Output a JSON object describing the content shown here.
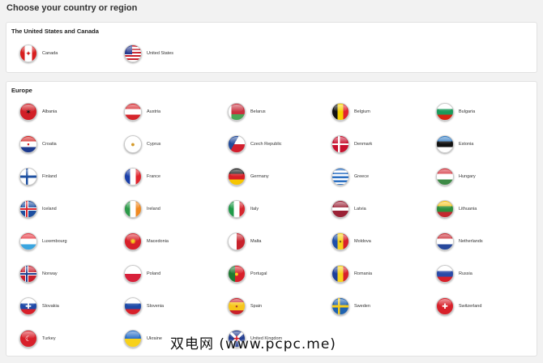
{
  "page_title": "Choose your country or region",
  "regions": [
    {
      "title": "The United States and Canada",
      "countries": [
        {
          "name": "Canada",
          "icon": "canada-flag-icon",
          "symbol": "✦",
          "symbol_color": "#cc1a1a",
          "flag": "linear-gradient(90deg,#d81e1e 0 28%,#ffffff 28% 72%,#d81e1e 72%)"
        },
        {
          "name": "United States",
          "icon": "united-states-flag-icon",
          "symbol": "",
          "flag": "linear-gradient(90deg,#2a3b8f 0 45%,transparent 45%) top left/100% 55% no-repeat, repeating-linear-gradient(180deg,#c8202a 0 2px,#ffffff 2px 4px)"
        }
      ]
    },
    {
      "title": "Europe",
      "countries": [
        {
          "name": "Albania",
          "icon": "albania-flag-icon",
          "symbol": "✶",
          "symbol_color": "#111111",
          "flag": "#d11f26"
        },
        {
          "name": "Austria",
          "icon": "austria-flag-icon",
          "symbol": "",
          "flag": "linear-gradient(180deg,#d6252b 0 33%,#ffffff 33% 67%,#d6252b 67%)"
        },
        {
          "name": "Belarus",
          "icon": "belarus-flag-icon",
          "symbol": "",
          "flag": "linear-gradient(90deg,#ffffff 0 18%,#c8313e 18% 18%,transparent 18%), linear-gradient(180deg,#c8313e 0 66%,#4aa657 66%)"
        },
        {
          "name": "Belgium",
          "icon": "belgium-flag-icon",
          "symbol": "",
          "flag": "linear-gradient(90deg,#111111 0 33%,#f6d100 33% 67%,#e2232e 67%)"
        },
        {
          "name": "Bulgaria",
          "icon": "bulgaria-flag-icon",
          "symbol": "",
          "flag": "linear-gradient(180deg,#ffffff 0 33%,#1a9a5a 33% 67%,#d62612 67%)"
        },
        {
          "name": "Croatia",
          "icon": "croatia-flag-icon",
          "symbol": "▪",
          "symbol_color": "#d42222",
          "flag": "linear-gradient(180deg,#d42222 0 33%,#ffffff 33% 67%,#1c3a8f 67%)"
        },
        {
          "name": "Cyprus",
          "icon": "cyprus-flag-icon",
          "symbol": "●",
          "symbol_color": "#d49a2a",
          "flag": "#ffffff"
        },
        {
          "name": "Czech Republic",
          "icon": "czech-republic-flag-icon",
          "symbol": "",
          "flag": "linear-gradient(120deg,#214a9a 0 40%,transparent 40%), linear-gradient(180deg,#ffffff 0 50%,#d21f2e 50%)"
        },
        {
          "name": "Denmark",
          "icon": "denmark-flag-icon",
          "symbol": "",
          "flag": "linear-gradient(90deg,transparent 0 36%,#ffffff 36% 48%,transparent 48%), linear-gradient(180deg,transparent 0 44%,#ffffff 44% 56%,transparent 56%), #c8102e"
        },
        {
          "name": "Estonia",
          "icon": "estonia-flag-icon",
          "symbol": "",
          "flag": "linear-gradient(180deg,#2f7bc4 0 33%,#111111 33% 67%,#ffffff 67%)"
        },
        {
          "name": "Finland",
          "icon": "finland-flag-icon",
          "symbol": "",
          "flag": "linear-gradient(90deg,transparent 0 34%,#1d4fa0 34% 48%,transparent 48%), linear-gradient(180deg,transparent 0 42%,#1d4fa0 42% 58%,transparent 58%), #ffffff"
        },
        {
          "name": "France",
          "icon": "france-flag-icon",
          "symbol": "",
          "flag": "linear-gradient(90deg,#1a3fa8 0 33%,#ffffff 33% 67%,#e0262f 67%)"
        },
        {
          "name": "Germany",
          "icon": "germany-flag-icon",
          "symbol": "",
          "flag": "linear-gradient(180deg,#111111 0 33%,#d81f26 33% 67%,#f7c600 67%)"
        },
        {
          "name": "Greece",
          "icon": "greece-flag-icon",
          "symbol": "",
          "flag": "repeating-linear-gradient(180deg,#2a6fc2 0 2.4px,#ffffff 2.4px 4.8px)"
        },
        {
          "name": "Hungary",
          "icon": "hungary-flag-icon",
          "symbol": "",
          "flag": "linear-gradient(180deg,#d22a35 0 33%,#ffffff 33% 67%,#3d8a46 67%)"
        },
        {
          "name": "Iceland",
          "icon": "iceland-flag-icon",
          "symbol": "",
          "flag": "linear-gradient(90deg,transparent 0 34%,#d9252d 34% 46%,transparent 46%), linear-gradient(180deg,transparent 0 44%,#d9252d 44% 56%,transparent 56%), linear-gradient(90deg,transparent 0 30%,#ffffff 30% 50%,transparent 50%), linear-gradient(180deg,transparent 0 40%,#ffffff 40% 60%,transparent 60%), #1d4fa0"
        },
        {
          "name": "Ireland",
          "icon": "ireland-flag-icon",
          "symbol": "",
          "flag": "linear-gradient(90deg,#2d9a49 0 33%,#ffffff 33% 67%,#f08a22 67%)"
        },
        {
          "name": "Italy",
          "icon": "italy-flag-icon",
          "symbol": "",
          "flag": "linear-gradient(90deg,#1f9a48 0 33%,#ffffff 33% 67%,#d6262e 67%)"
        },
        {
          "name": "Latvia",
          "icon": "latvia-flag-icon",
          "symbol": "",
          "flag": "linear-gradient(180deg,#9b2236 0 40%,#ffffff 40% 60%,#9b2236 60%)"
        },
        {
          "name": "Lithuania",
          "icon": "lithuania-flag-icon",
          "symbol": "",
          "flag": "linear-gradient(180deg,#f5c21b 0 33%,#2e8f3c 33% 67%,#c4272f 67%)"
        },
        {
          "name": "Luxembourg",
          "icon": "luxembourg-flag-icon",
          "symbol": "",
          "flag": "linear-gradient(180deg,#e5323c 0 33%,#ffffff 33% 67%,#39a5e0 67%)"
        },
        {
          "name": "Macedonia",
          "icon": "macedonia-flag-icon",
          "symbol": "✺",
          "symbol_color": "#f7d11a",
          "flag": "#d8202a"
        },
        {
          "name": "Malta",
          "icon": "malta-flag-icon",
          "symbol": "",
          "flag": "linear-gradient(90deg,#ffffff 0 50%,#c8222c 50%)"
        },
        {
          "name": "Moldova",
          "icon": "moldova-flag-icon",
          "symbol": "▪",
          "symbol_color": "#8a5a1a",
          "flag": "linear-gradient(90deg,#1f4fa8 0 33%,#f7d11a 33% 67%,#d8202a 67%)"
        },
        {
          "name": "Netherlands",
          "icon": "netherlands-flag-icon",
          "symbol": "",
          "flag": "linear-gradient(180deg,#c8232c 0 33%,#ffffff 33% 67%,#27489c 67%)"
        },
        {
          "name": "Norway",
          "icon": "norway-flag-icon",
          "symbol": "",
          "flag": "linear-gradient(90deg,transparent 0 34%,#1f3f8f 34% 46%,transparent 46%), linear-gradient(180deg,transparent 0 44%,#1f3f8f 44% 56%,transparent 56%), linear-gradient(90deg,transparent 0 30%,#ffffff 30% 50%,transparent 50%), linear-gradient(180deg,transparent 0 40%,#ffffff 40% 60%,transparent 60%), #c8202e"
        },
        {
          "name": "Poland",
          "icon": "poland-flag-icon",
          "symbol": "",
          "flag": "linear-gradient(180deg,#ffffff 0 50%,#d8203a 50%)"
        },
        {
          "name": "Portugal",
          "icon": "portugal-flag-icon",
          "symbol": "●",
          "symbol_color": "#f7d11a",
          "flag": "linear-gradient(90deg,#1e7a32 0 40%,#d8202a 40%)"
        },
        {
          "name": "Romania",
          "icon": "romania-flag-icon",
          "symbol": "",
          "flag": "linear-gradient(90deg,#1d3f9a 0 33%,#f7d11a 33% 67%,#d8202a 67%)"
        },
        {
          "name": "Russia",
          "icon": "russia-flag-icon",
          "symbol": "",
          "flag": "linear-gradient(180deg,#ffffff 0 33%,#2a4aa8 33% 67%,#d8202a 67%)"
        },
        {
          "name": "Slovakia",
          "icon": "slovakia-flag-icon",
          "symbol": "✚",
          "symbol_color": "#ffffff",
          "flag": "linear-gradient(180deg,#ffffff 0 33%,#1e4aa8 33% 67%,#d8202a 67%)"
        },
        {
          "name": "Slovenia",
          "icon": "slovenia-flag-icon",
          "symbol": "",
          "flag": "linear-gradient(180deg,#ffffff 0 33%,#1e4aa8 33% 67%,#d8202a 67%)"
        },
        {
          "name": "Spain",
          "icon": "spain-flag-icon",
          "symbol": "▪",
          "symbol_color": "#b0402a",
          "flag": "linear-gradient(180deg,#c8202a 0 25%,#f7c61a 25% 75%,#c8202a 75%)"
        },
        {
          "name": "Sweden",
          "icon": "sweden-flag-icon",
          "symbol": "",
          "flag": "linear-gradient(90deg,transparent 0 34%,#f7cc1a 34% 48%,transparent 48%), linear-gradient(180deg,transparent 0 42%,#f7cc1a 42% 58%,transparent 58%), #1f62b0"
        },
        {
          "name": "Switzerland",
          "icon": "switzerland-flag-icon",
          "symbol": "✚",
          "symbol_color": "#ffffff",
          "flag": "#d8202a"
        },
        {
          "name": "Turkey",
          "icon": "turkey-flag-icon",
          "symbol": "☾",
          "symbol_color": "#ffffff",
          "flag": "#d8202a"
        },
        {
          "name": "Ukraine",
          "icon": "ukraine-flag-icon",
          "symbol": "",
          "flag": "linear-gradient(180deg,#2a6fc8 0 50%,#f7d11a 50%)"
        },
        {
          "name": "United Kingdom",
          "icon": "united-kingdom-flag-icon",
          "symbol": "✚",
          "symbol_color": "#d8202a",
          "flag": "linear-gradient(45deg,transparent 0 44%,#ffffff 44% 56%,transparent 56%), linear-gradient(-45deg,transparent 0 44%,#ffffff 44% 56%,transparent 56%), #1f3a8f"
        }
      ]
    }
  ],
  "watermark": "双电网 (www.pcpc.me)"
}
